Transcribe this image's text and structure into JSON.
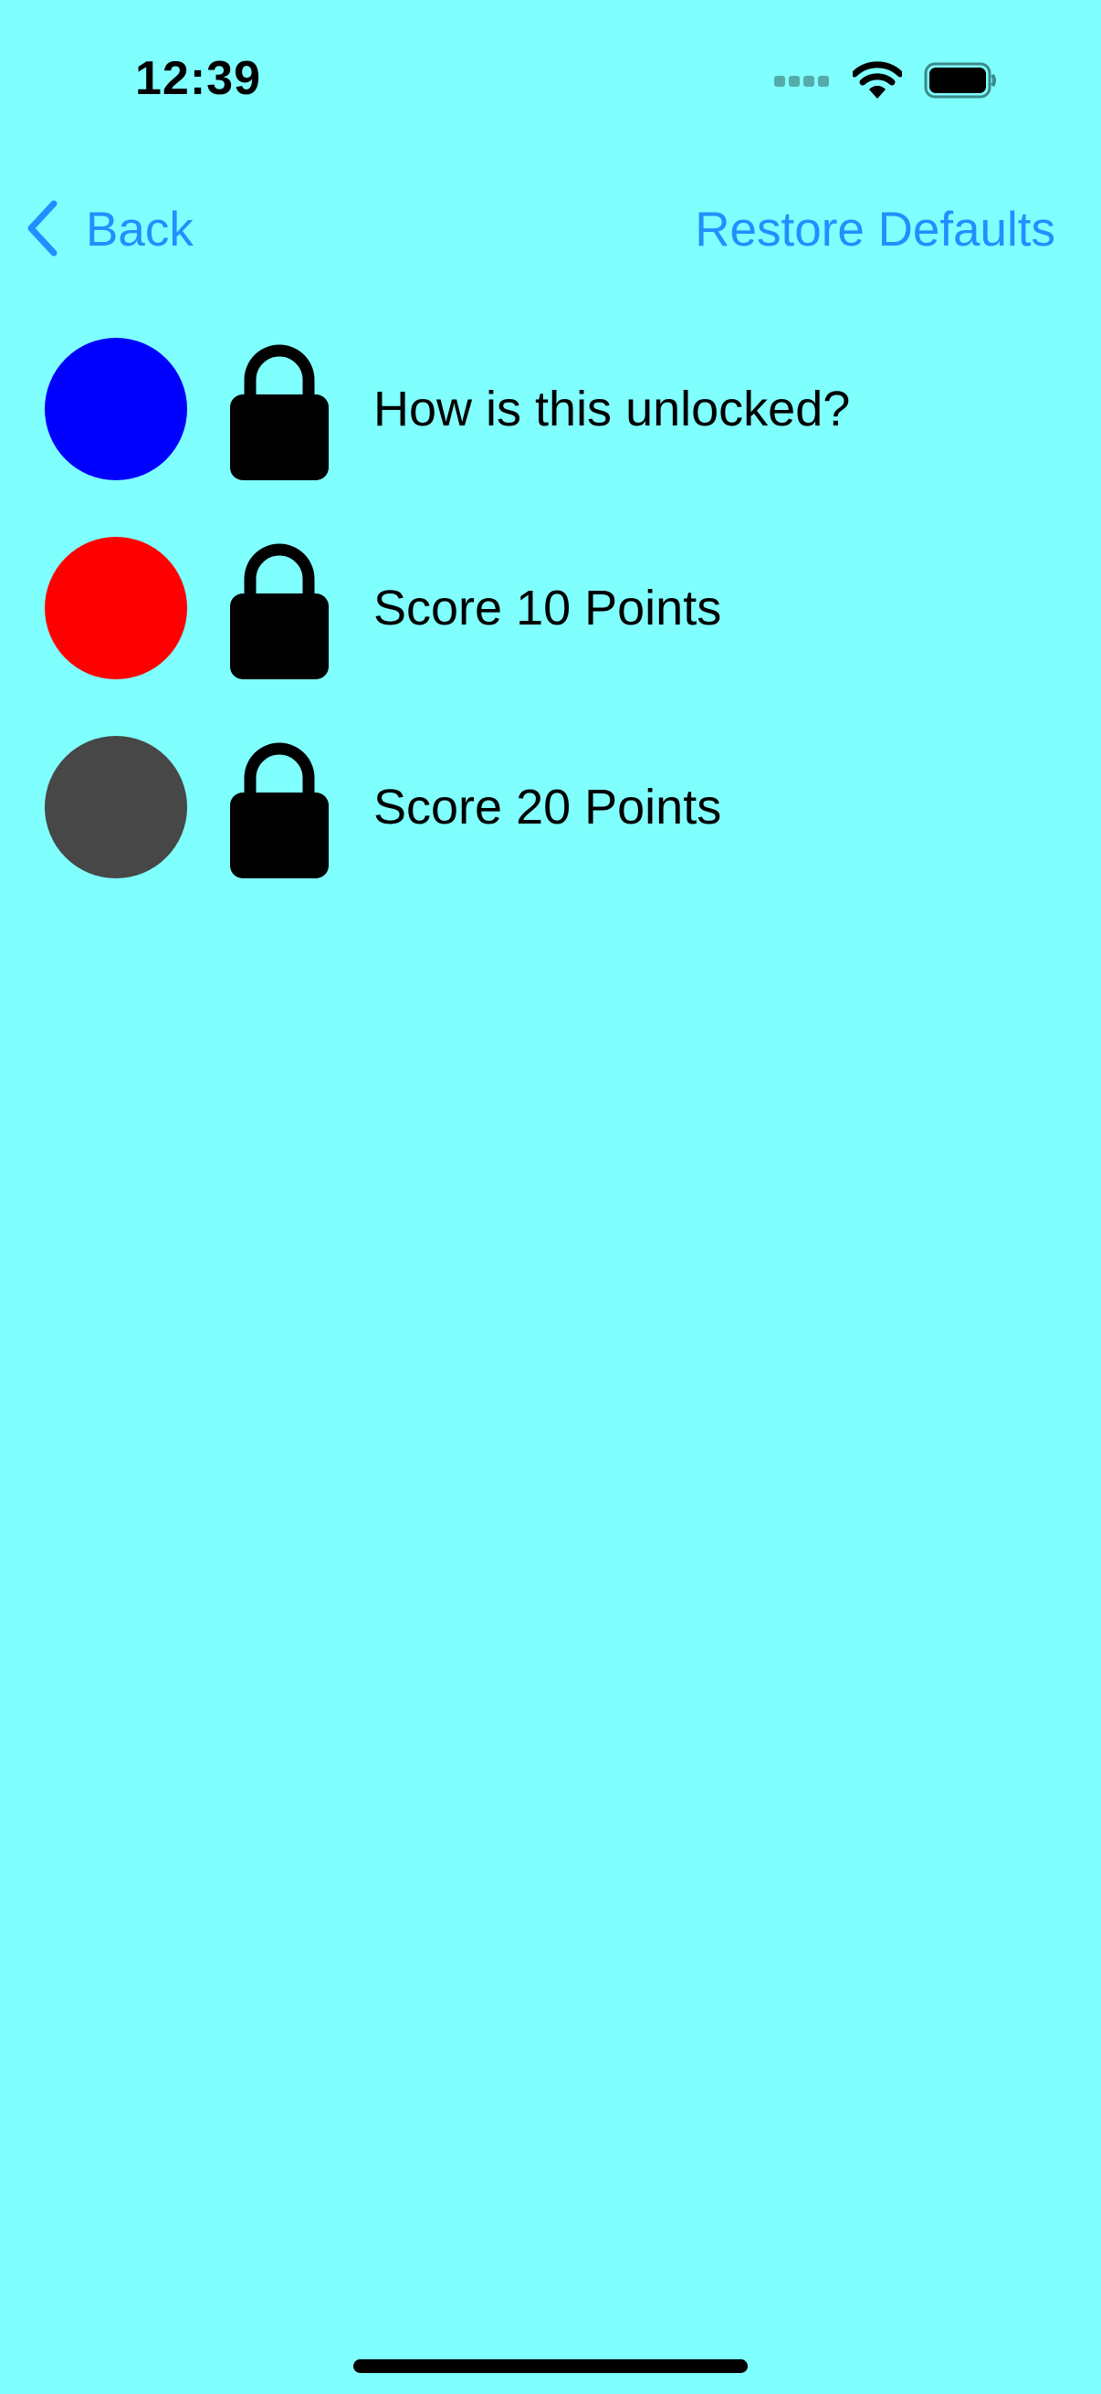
{
  "status_bar": {
    "time": "12:39",
    "icons": [
      "signal-icon",
      "wifi-icon",
      "battery-icon"
    ]
  },
  "nav": {
    "back_label": "Back",
    "restore_label": "Restore Defaults",
    "accent_color": "#1E90FF"
  },
  "background_color": "#80FFFF",
  "items": [
    {
      "label": "How is this unlocked?",
      "color": "#0000FF",
      "locked": true
    },
    {
      "label": "Score 10 Points",
      "color": "#FF0000",
      "locked": true
    },
    {
      "label": "Score 20 Points",
      "color": "#474747",
      "locked": true
    }
  ]
}
